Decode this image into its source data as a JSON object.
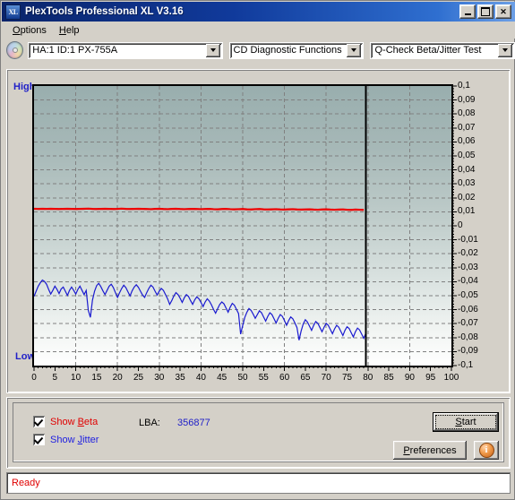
{
  "window": {
    "title": "PlexTools Professional XL V3.16",
    "icon": "XL",
    "minimize_label": "minimize",
    "maximize_label": "maximize",
    "close_label": "✕"
  },
  "menu": {
    "items": [
      {
        "label": "Options",
        "mnemonic": "O"
      },
      {
        "label": "Help",
        "mnemonic": "H"
      }
    ]
  },
  "toolbar": {
    "drive": {
      "value": "HA:1 ID:1  PX-755A",
      "icon": "disc-icon"
    },
    "function": {
      "value": "CD Diagnostic Functions"
    },
    "test": {
      "value": "Q-Check Beta/Jitter Test"
    }
  },
  "chart_data": {
    "type": "line",
    "title": "",
    "xlabel": "",
    "ylabel": "",
    "xlim": [
      0,
      100
    ],
    "ylim": [
      -0.1,
      0.1
    ],
    "grid": true,
    "legend": "none",
    "left_axis_top_label": "High",
    "left_axis_bottom_label": "Low",
    "xticks": [
      0,
      5,
      10,
      15,
      20,
      25,
      30,
      35,
      40,
      45,
      50,
      55,
      60,
      65,
      70,
      75,
      80,
      85,
      90,
      95,
      100
    ],
    "xtick_labels": [
      "0",
      "5",
      "10",
      "15",
      "20",
      "25",
      "30",
      "35",
      "40",
      "45",
      "50",
      "55",
      "60",
      "65",
      "70",
      "75",
      "80",
      "85",
      "90",
      "95",
      "100"
    ],
    "yticks": [
      0.1,
      0.09,
      0.08,
      0.07,
      0.06,
      0.05,
      0.04,
      0.03,
      0.02,
      0.01,
      0,
      -0.01,
      -0.02,
      -0.03,
      -0.04,
      -0.05,
      -0.06,
      -0.07,
      -0.08,
      -0.09,
      -0.1
    ],
    "ytick_labels": [
      "0,1",
      "0,09",
      "0,08",
      "0,07",
      "0,06",
      "0,05",
      "0,04",
      "0,03",
      "0,02",
      "0,01",
      "0",
      "-0,01",
      "-0,02",
      "-0,03",
      "-0,04",
      "-0,05",
      "-0,06",
      "-0,07",
      "-0,08",
      "-0,09",
      "-0,1"
    ],
    "data_end_marker_x": 79.5,
    "series": [
      {
        "name": "Beta",
        "color": "#ee0000",
        "x": [
          0,
          1,
          2,
          3,
          4,
          5,
          6,
          7,
          8,
          9,
          10,
          11,
          12,
          13,
          14,
          15,
          16,
          17,
          18,
          19,
          20,
          21,
          22,
          23,
          24,
          25,
          26,
          27,
          28,
          29,
          30,
          31,
          32,
          33,
          34,
          35,
          36,
          37,
          38,
          39,
          40,
          41,
          42,
          43,
          44,
          45,
          46,
          47,
          48,
          49,
          50,
          51,
          52,
          53,
          54,
          55,
          56,
          57,
          58,
          59,
          60,
          61,
          62,
          63,
          64,
          65,
          66,
          67,
          68,
          69,
          70,
          71,
          72,
          73,
          74,
          75,
          76,
          77,
          78,
          79
        ],
        "values": [
          0.0122,
          0.0121,
          0.0122,
          0.0121,
          0.0122,
          0.0121,
          0.012,
          0.0121,
          0.0122,
          0.0121,
          0.012,
          0.0121,
          0.0122,
          0.0123,
          0.0121,
          0.012,
          0.0121,
          0.0122,
          0.0121,
          0.012,
          0.0121,
          0.0123,
          0.0121,
          0.012,
          0.0121,
          0.0122,
          0.0121,
          0.012,
          0.0119,
          0.0121,
          0.0122,
          0.012,
          0.0119,
          0.0121,
          0.0122,
          0.012,
          0.0119,
          0.012,
          0.0121,
          0.012,
          0.0119,
          0.012,
          0.0121,
          0.0119,
          0.0118,
          0.012,
          0.0121,
          0.0119,
          0.0118,
          0.0119,
          0.012,
          0.0118,
          0.0117,
          0.0119,
          0.012,
          0.0118,
          0.0117,
          0.0118,
          0.0119,
          0.0117,
          0.0116,
          0.0118,
          0.0119,
          0.0117,
          0.0116,
          0.0117,
          0.0118,
          0.0116,
          0.0115,
          0.0117,
          0.0118,
          0.0116,
          0.0115,
          0.0116,
          0.0117,
          0.0115,
          0.0114,
          0.0116,
          0.0115,
          0.0114
        ]
      },
      {
        "name": "Jitter",
        "color": "#1a1ad0",
        "x": [
          0,
          0.5,
          1,
          1.5,
          2,
          2.5,
          3,
          3.5,
          4,
          4.5,
          5,
          5.5,
          6,
          6.5,
          7,
          7.5,
          8,
          8.5,
          9,
          9.5,
          10,
          10.5,
          11,
          11.5,
          12,
          12.5,
          13,
          13.5,
          14,
          14.5,
          15,
          15.5,
          16,
          16.5,
          17,
          17.5,
          18,
          18.5,
          19,
          19.5,
          20,
          20.5,
          21,
          21.5,
          22,
          22.5,
          23,
          23.5,
          24,
          24.5,
          25,
          25.5,
          26,
          26.5,
          27,
          27.5,
          28,
          28.5,
          29,
          29.5,
          30,
          30.5,
          31,
          31.5,
          32,
          32.5,
          33,
          33.5,
          34,
          34.5,
          35,
          35.5,
          36,
          36.5,
          37,
          37.5,
          38,
          38.5,
          39,
          39.5,
          40,
          40.5,
          41,
          41.5,
          42,
          42.5,
          43,
          43.5,
          44,
          44.5,
          45,
          45.5,
          46,
          46.5,
          47,
          47.5,
          48,
          48.5,
          49,
          49.5,
          50,
          50.5,
          51,
          51.5,
          52,
          52.5,
          53,
          53.5,
          54,
          54.5,
          55,
          55.5,
          56,
          56.5,
          57,
          57.5,
          58,
          58.5,
          59,
          59.5,
          60,
          60.5,
          61,
          61.5,
          62,
          62.5,
          63,
          63.5,
          64,
          64.5,
          65,
          65.5,
          66,
          66.5,
          67,
          67.5,
          68,
          68.5,
          69,
          69.5,
          70,
          70.5,
          71,
          71.5,
          72,
          72.5,
          73,
          73.5,
          74,
          74.5,
          75,
          75.5,
          76,
          76.5,
          77,
          77.5,
          78,
          78.5,
          79,
          79.5
        ],
        "values": [
          -0.0505,
          -0.0468,
          -0.0432,
          -0.0408,
          -0.0388,
          -0.0398,
          -0.0418,
          -0.0455,
          -0.0488,
          -0.0462,
          -0.0432,
          -0.0455,
          -0.0485,
          -0.0452,
          -0.0438,
          -0.0468,
          -0.0498,
          -0.0462,
          -0.0438,
          -0.0462,
          -0.0488,
          -0.0455,
          -0.0432,
          -0.0462,
          -0.0492,
          -0.0462,
          -0.0605,
          -0.0655,
          -0.0532,
          -0.0468,
          -0.0428,
          -0.0412,
          -0.0435,
          -0.0465,
          -0.0492,
          -0.0462,
          -0.0432,
          -0.0418,
          -0.0442,
          -0.0478,
          -0.0512,
          -0.0478,
          -0.0448,
          -0.0425,
          -0.0442,
          -0.0472,
          -0.0502,
          -0.0465,
          -0.0438,
          -0.0422,
          -0.044,
          -0.0468,
          -0.0495,
          -0.0512,
          -0.0478,
          -0.0448,
          -0.0425,
          -0.0438,
          -0.0468,
          -0.0495,
          -0.0468,
          -0.0448,
          -0.0462,
          -0.0492,
          -0.0522,
          -0.0562,
          -0.0535,
          -0.0502,
          -0.0478,
          -0.0492,
          -0.0518,
          -0.0548,
          -0.0515,
          -0.0492,
          -0.0505,
          -0.0535,
          -0.0562,
          -0.053,
          -0.0508,
          -0.0522,
          -0.0548,
          -0.0578,
          -0.0545,
          -0.0522,
          -0.0538,
          -0.0565,
          -0.0598,
          -0.0625,
          -0.0592,
          -0.0562,
          -0.0545,
          -0.0558,
          -0.0588,
          -0.0618,
          -0.0582,
          -0.0555,
          -0.0568,
          -0.0598,
          -0.0628,
          -0.0775,
          -0.0712,
          -0.0655,
          -0.0618,
          -0.0592,
          -0.0605,
          -0.0632,
          -0.0662,
          -0.0635,
          -0.0608,
          -0.0622,
          -0.0652,
          -0.0682,
          -0.0648,
          -0.0622,
          -0.0635,
          -0.0665,
          -0.0695,
          -0.0662,
          -0.0635,
          -0.0648,
          -0.0678,
          -0.0712,
          -0.0678,
          -0.0652,
          -0.0665,
          -0.0695,
          -0.0728,
          -0.0818,
          -0.0752,
          -0.0702,
          -0.0672,
          -0.0688,
          -0.0718,
          -0.0748,
          -0.0712,
          -0.0685,
          -0.0698,
          -0.0728,
          -0.0758,
          -0.0725,
          -0.0698,
          -0.0712,
          -0.0742,
          -0.0772,
          -0.0738,
          -0.0712,
          -0.0725,
          -0.0755,
          -0.0785,
          -0.0748,
          -0.0722,
          -0.0735,
          -0.0765,
          -0.0795,
          -0.0758,
          -0.0732,
          -0.0745,
          -0.0775,
          -0.0805,
          -0.0768,
          -0.0742,
          -0.0755
        ]
      }
    ]
  },
  "controls": {
    "show_beta": {
      "label": "Show Beta",
      "mnemonic": "B",
      "checked": true,
      "color": "#e00000"
    },
    "show_jitter": {
      "label": "Show Jitter",
      "mnemonic": "J",
      "checked": true,
      "color": "#2020e0"
    },
    "lba_label": "LBA:",
    "lba_value": "356877",
    "start_button": {
      "label": "Start",
      "mnemonic": "S"
    },
    "preferences_button": {
      "label": "Preferences",
      "mnemonic": "P"
    },
    "info_button": {
      "label": "i"
    }
  },
  "status": {
    "text": "Ready"
  }
}
